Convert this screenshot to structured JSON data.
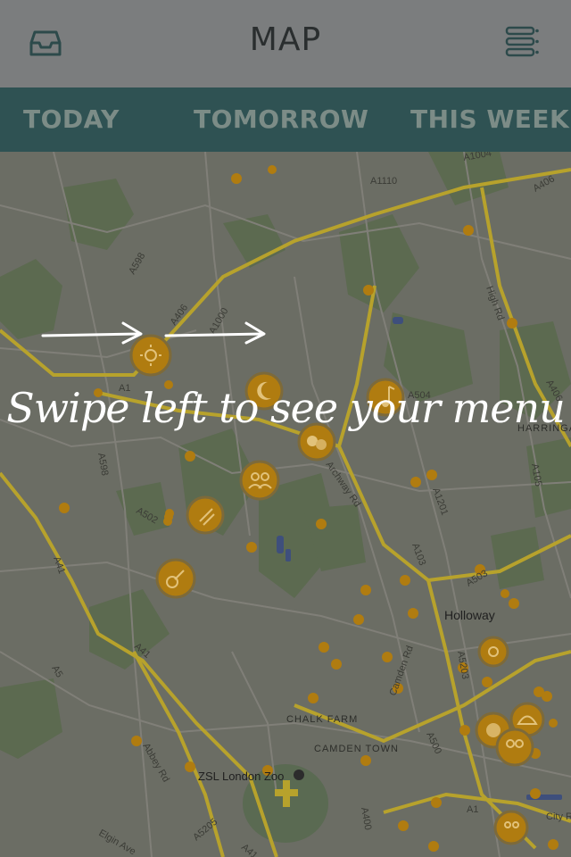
{
  "header": {
    "title": "MAP",
    "inbox_icon": "inbox-icon",
    "menu_icon": "list-menu-icon"
  },
  "tabs": [
    {
      "label": "TODAY"
    },
    {
      "label": "TOMORROW"
    },
    {
      "label": "THIS WEEK"
    }
  ],
  "map": {
    "road_labels": [
      "A1004",
      "A1110",
      "A406",
      "A598",
      "A406",
      "A1000",
      "A504",
      "High Rd",
      "A1",
      "A598",
      "A41",
      "A502",
      "Archway Rd",
      "A1201",
      "A103",
      "A503",
      "A5203",
      "A41",
      "A5",
      "Abbey Rd",
      "A5205",
      "A41",
      "Elgin Ave",
      "A400",
      "A500",
      "Camden Rd",
      "A1",
      "A406",
      "A105"
    ],
    "place_labels": [
      "Holloway",
      "ZSL London Zoo",
      "HARRINGAY",
      "CHALK FARM",
      "CAMDEN TOWN",
      "City R"
    ],
    "event_markers": [
      "sun-icon",
      "moon-icon",
      "music-note-icon",
      "theatre-masks-icon",
      "people-icon",
      "music-note-icon",
      "guitar-icon",
      "sun-icon",
      "cloche-icon",
      "globe-icon",
      "people-icon",
      "people-icon"
    ]
  },
  "overlay": {
    "instruction": "Swipe left to see your menu"
  },
  "colors": {
    "header_bg": "#7b7d7e",
    "tab_bar_bg": "#2f5253",
    "marker_color": "#c48a0d"
  }
}
